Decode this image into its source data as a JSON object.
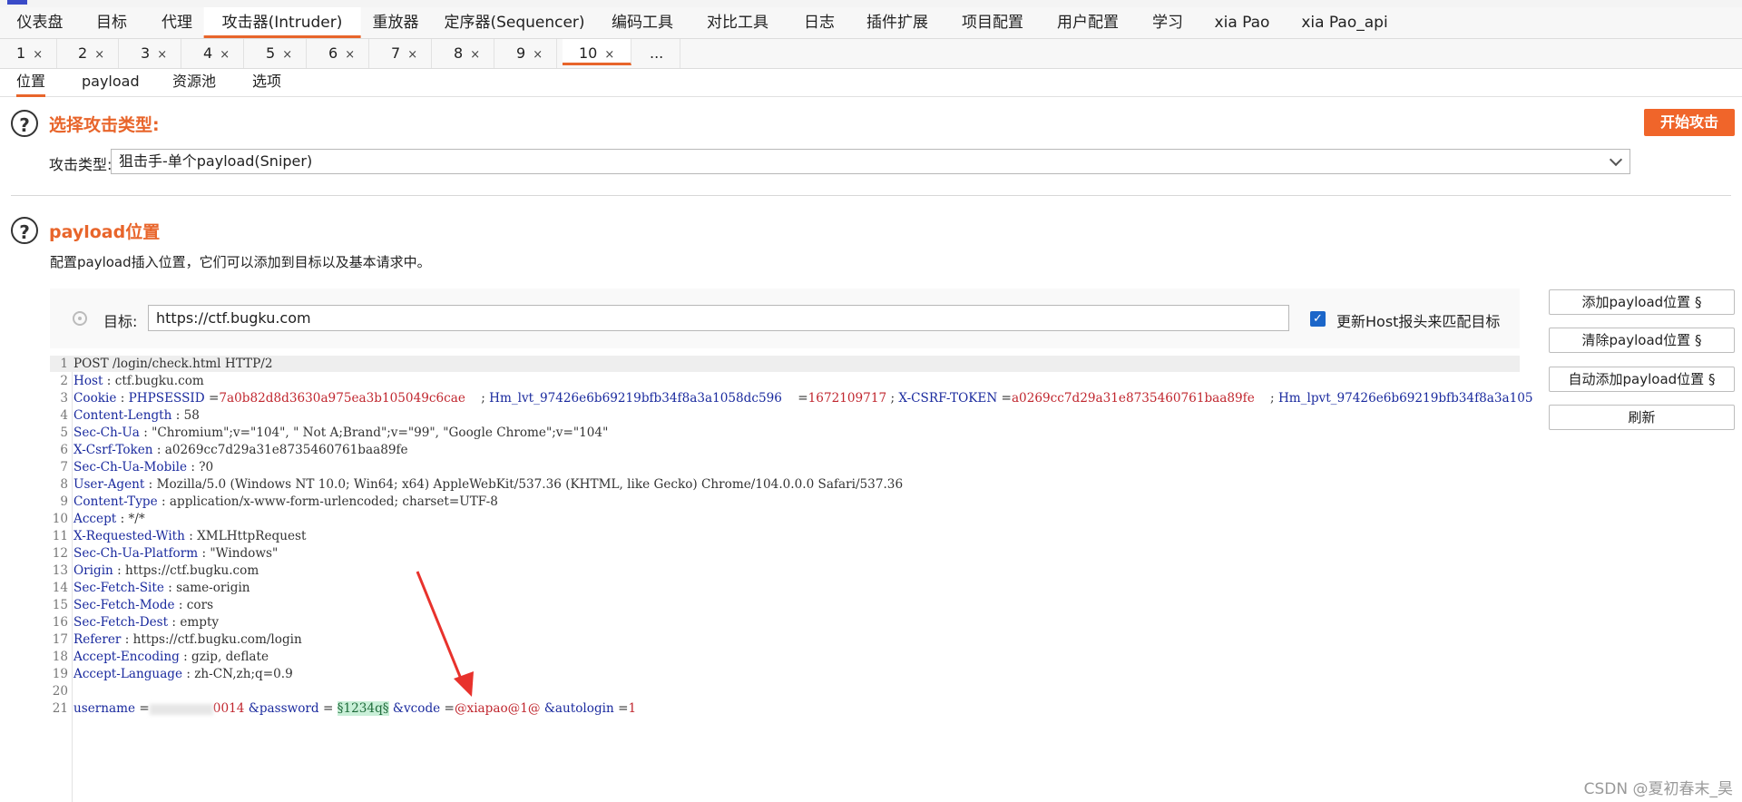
{
  "menu": [
    "仪表盘",
    "目标",
    "代理",
    "攻击器(Intruder)",
    "重放器",
    "定序器(Sequencer)",
    "编码工具",
    "对比工具",
    "日志",
    "插件扩展",
    "项目配置",
    "用户配置",
    "学习",
    "xia Pao",
    "xia Pao_api"
  ],
  "tabs": [
    "1",
    "2",
    "3",
    "4",
    "5",
    "6",
    "7",
    "8",
    "9",
    "10",
    "..."
  ],
  "tab_close": "×",
  "subtabs": [
    "位置",
    "payload",
    "资源池",
    "选项"
  ],
  "attack_section": {
    "title": "选择攻击类型:",
    "start_button": "开始攻击",
    "type_label": "攻击类型:",
    "type_value": "狙击手-单个payload(Sniper)"
  },
  "positions_section": {
    "title": "payload位置",
    "description": "配置payload插入位置，它们可以添加到目标以及基本请求中。",
    "target_label": "目标:",
    "target_value": "https://ctf.bugku.com",
    "update_host_label": "更新Host报头来匹配目标",
    "update_host_checked": true,
    "buttons": {
      "add": "添加payload位置 §",
      "clear": "清除payload位置 §",
      "auto": "自动添加payload位置 §",
      "refresh": "刷新"
    }
  },
  "request": {
    "l1": "POST  /login/check.html   HTTP/2",
    "l2k": "Host",
    "l2v": " : ctf.bugku.com",
    "l3k": "Cookie",
    "c1k": " PHPSESSID ",
    "c1v": "7a0b82d8d3630a975ea3b105049c6cae",
    "c2k": "Hm_lvt_97426e6b69219bfb34f8a3a1058dc596",
    "c2v": "1672109717",
    "c3k": "X-CSRF-TOKEN",
    "c3v": "a0269cc7d29a31e8735460761baa89fe",
    "c4k": "Hm_lpvt_97426e6b69219bfb34f8a3a105",
    "l4k": "Content-Length",
    "l4v": " : 58",
    "l5k": "Sec-Ch-Ua",
    "l5v": " : \"Chromium\";v=\"104\",   \" Not A;Brand\";v=\"99\",   \"Google  Chrome\";v=\"104\"",
    "l6k": "X-Csrf-Token",
    "l6v": " : a0269cc7d29a31e8735460761baa89fe",
    "l7k": "Sec-Ch-Ua-Mobile",
    "l7v": " : ?0",
    "l8k": "User-Agent",
    "l8v": " : Mozilla/5.0  (Windows  NT 10.0;  Win64;  x64) AppleWebKit/537.36   (KHTML,  like  Gecko)  Chrome/104.0.0.0   Safari/537.36",
    "l9k": "Content-Type",
    "l9v": " : application/x-www-form-urlencoded;    charset=UTF-8",
    "l10k": "Accept",
    "l10v": " : */*",
    "l11k": "X-Requested-With",
    "l11v": " : XMLHttpRequest",
    "l12k": "Sec-Ch-Ua-Platform",
    "l12v": " : \"Windows\"",
    "l13k": "Origin",
    "l13v": " : https://ctf.bugku.com",
    "l14k": "Sec-Fetch-Site",
    "l14v": " : same-origin",
    "l15k": "Sec-Fetch-Mode",
    "l15v": " : cors",
    "l16k": "Sec-Fetch-Dest",
    "l16v": " : empty",
    "l17k": "Referer",
    "l17v": " : https://ctf.bugku.com/login",
    "l18k": "Accept-Encoding",
    "l18v": " : gzip,  deflate",
    "l19k": "Accept-Language",
    "l19v": " : zh-CN,zh;q=0.9",
    "p1k": "username",
    "p1v": "0014",
    "p2k": "&password",
    "p2v": "§1234q§",
    "p3k": "&vcode",
    "p3v": "@xiapao@1@",
    "p4k": "&autologin",
    "p4v": "1"
  },
  "watermark": "CSDN @夏初春末_昊",
  "colors": {
    "accent": "#e8652b",
    "header_key": "#1a2a9e",
    "value_red": "#c0262e",
    "marker_bg": "#c9efd8",
    "arrow": "#e8322c"
  },
  "icons": [
    "help-icon",
    "crosshair-icon",
    "checkbox-icon",
    "chevron-down-icon",
    "arrow-annotation"
  ]
}
